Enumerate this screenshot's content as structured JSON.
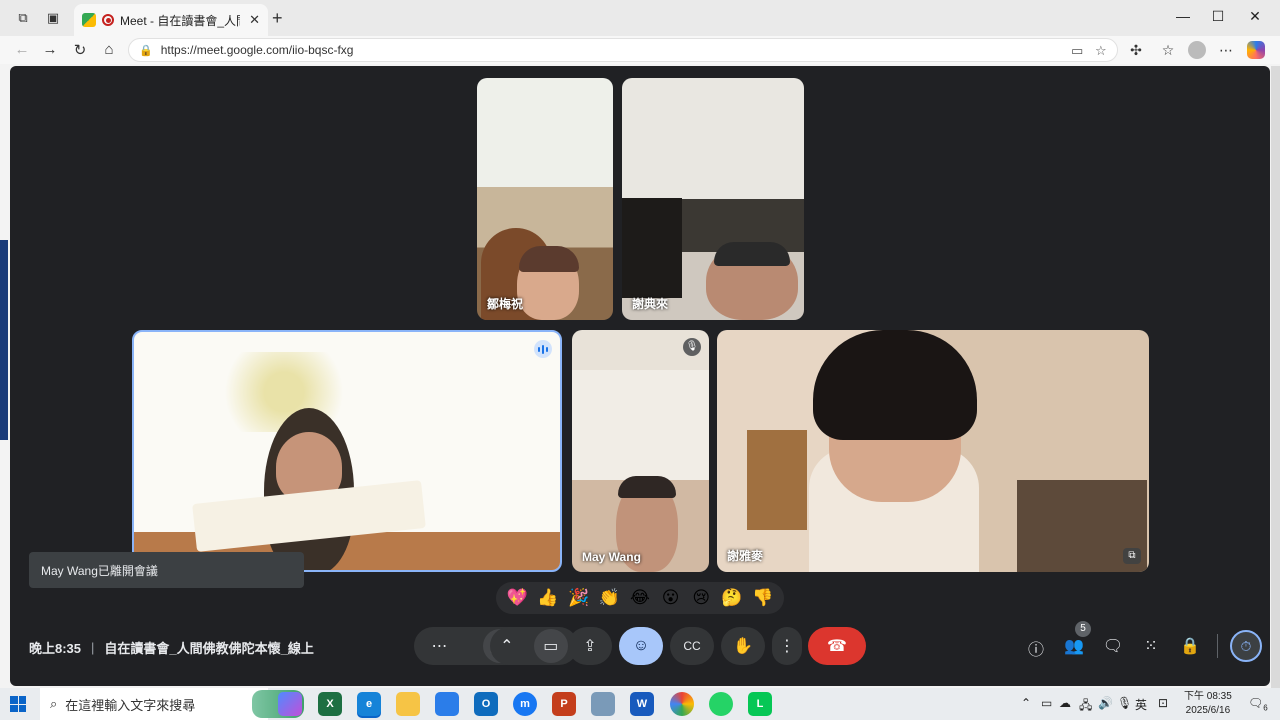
{
  "browser": {
    "tab_title": "Meet - 自在讀書會_人間佛教",
    "url": "https://meet.google.com/iio-bqsc-fxg"
  },
  "meeting": {
    "participants": [
      {
        "name": "鄒梅祝"
      },
      {
        "name": "謝典來"
      },
      {
        "name": ""
      },
      {
        "name": "May Wang"
      },
      {
        "name": "謝雅麥"
      }
    ],
    "toast": "May Wang已離開會議",
    "reactions": [
      "💖",
      "👍",
      "🎉",
      "👏",
      "😂",
      "😮",
      "😢",
      "🤔",
      "👎"
    ],
    "time": "晚上8:35",
    "title": "自在讀書會_人間佛教佛陀本懷_線上",
    "people_count": "5"
  },
  "taskbar": {
    "search_placeholder": "在這裡輸入文字來搜尋",
    "ime": "英",
    "clock_time": "下午 08:35",
    "clock_date": "2025/6/16",
    "notifications": "6"
  },
  "colors": {
    "meet_bg": "#202124",
    "end_call": "#dc362e",
    "selected_button": "#a8c7fa",
    "active_speaker_border": "#8ab4f8"
  }
}
